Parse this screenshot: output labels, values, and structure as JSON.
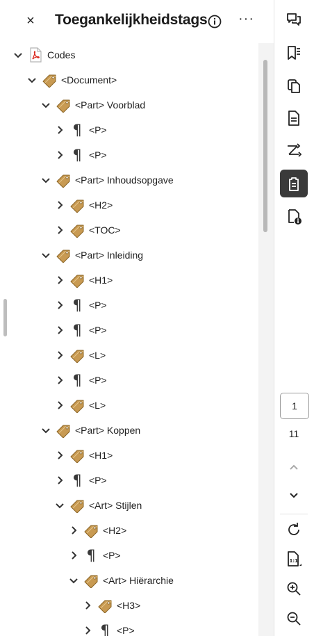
{
  "panel": {
    "close_label": "×",
    "title": "Toegankelijkheidstags",
    "more_label": "···"
  },
  "tree": [
    {
      "label": "Codes",
      "icon": "pdf-icon",
      "expanded": true
    },
    {
      "label": "<Document>",
      "icon": "tag-icon",
      "expanded": true
    },
    {
      "label": "<Part> Voorblad",
      "icon": "tag-icon",
      "expanded": true
    },
    {
      "label": "<P>",
      "icon": "paragraph-icon",
      "expanded": false
    },
    {
      "label": "<P>",
      "icon": "paragraph-icon",
      "expanded": false
    },
    {
      "label": "<Part> Inhoudsopgave",
      "icon": "tag-icon",
      "expanded": true
    },
    {
      "label": "<H2>",
      "icon": "tag-icon",
      "expanded": false
    },
    {
      "label": "<TOC>",
      "icon": "tag-icon",
      "expanded": false
    },
    {
      "label": "<Part> Inleiding",
      "icon": "tag-icon",
      "expanded": true
    },
    {
      "label": "<H1>",
      "icon": "tag-icon",
      "expanded": false
    },
    {
      "label": "<P>",
      "icon": "paragraph-icon",
      "expanded": false
    },
    {
      "label": "<P>",
      "icon": "paragraph-icon",
      "expanded": false
    },
    {
      "label": "<L>",
      "icon": "tag-icon",
      "expanded": false
    },
    {
      "label": "<P>",
      "icon": "paragraph-icon",
      "expanded": false
    },
    {
      "label": "<L>",
      "icon": "tag-icon",
      "expanded": false
    },
    {
      "label": "<Part> Koppen",
      "icon": "tag-icon",
      "expanded": true
    },
    {
      "label": "<H1>",
      "icon": "tag-icon",
      "expanded": false
    },
    {
      "label": "<P>",
      "icon": "paragraph-icon",
      "expanded": false
    },
    {
      "label": "<Art> Stijlen",
      "icon": "tag-icon",
      "expanded": true
    },
    {
      "label": "<H2>",
      "icon": "tag-icon",
      "expanded": false
    },
    {
      "label": "<P>",
      "icon": "paragraph-icon",
      "expanded": false
    },
    {
      "label": "<Art> Hiërarchie",
      "icon": "tag-icon",
      "expanded": true
    },
    {
      "label": "<H3>",
      "icon": "tag-icon",
      "expanded": false
    },
    {
      "label": "<P>",
      "icon": "paragraph-icon",
      "expanded": false
    }
  ],
  "toolbar": {
    "buttons": [
      {
        "name": "comments-icon",
        "active": false
      },
      {
        "name": "bookmarks-icon",
        "active": false
      },
      {
        "name": "pages-icon",
        "active": false
      },
      {
        "name": "document-icon",
        "active": false
      },
      {
        "name": "order-icon",
        "active": false
      },
      {
        "name": "accessibility-tags-icon",
        "active": true
      },
      {
        "name": "document-properties-icon",
        "active": false
      }
    ],
    "current_page": "1",
    "page_count": "11"
  },
  "colors": {
    "tag_fill": "#c89a52",
    "tag_stroke": "#8a6424",
    "pdf_red": "#d9271d",
    "active_bg": "#3a3a3a"
  }
}
